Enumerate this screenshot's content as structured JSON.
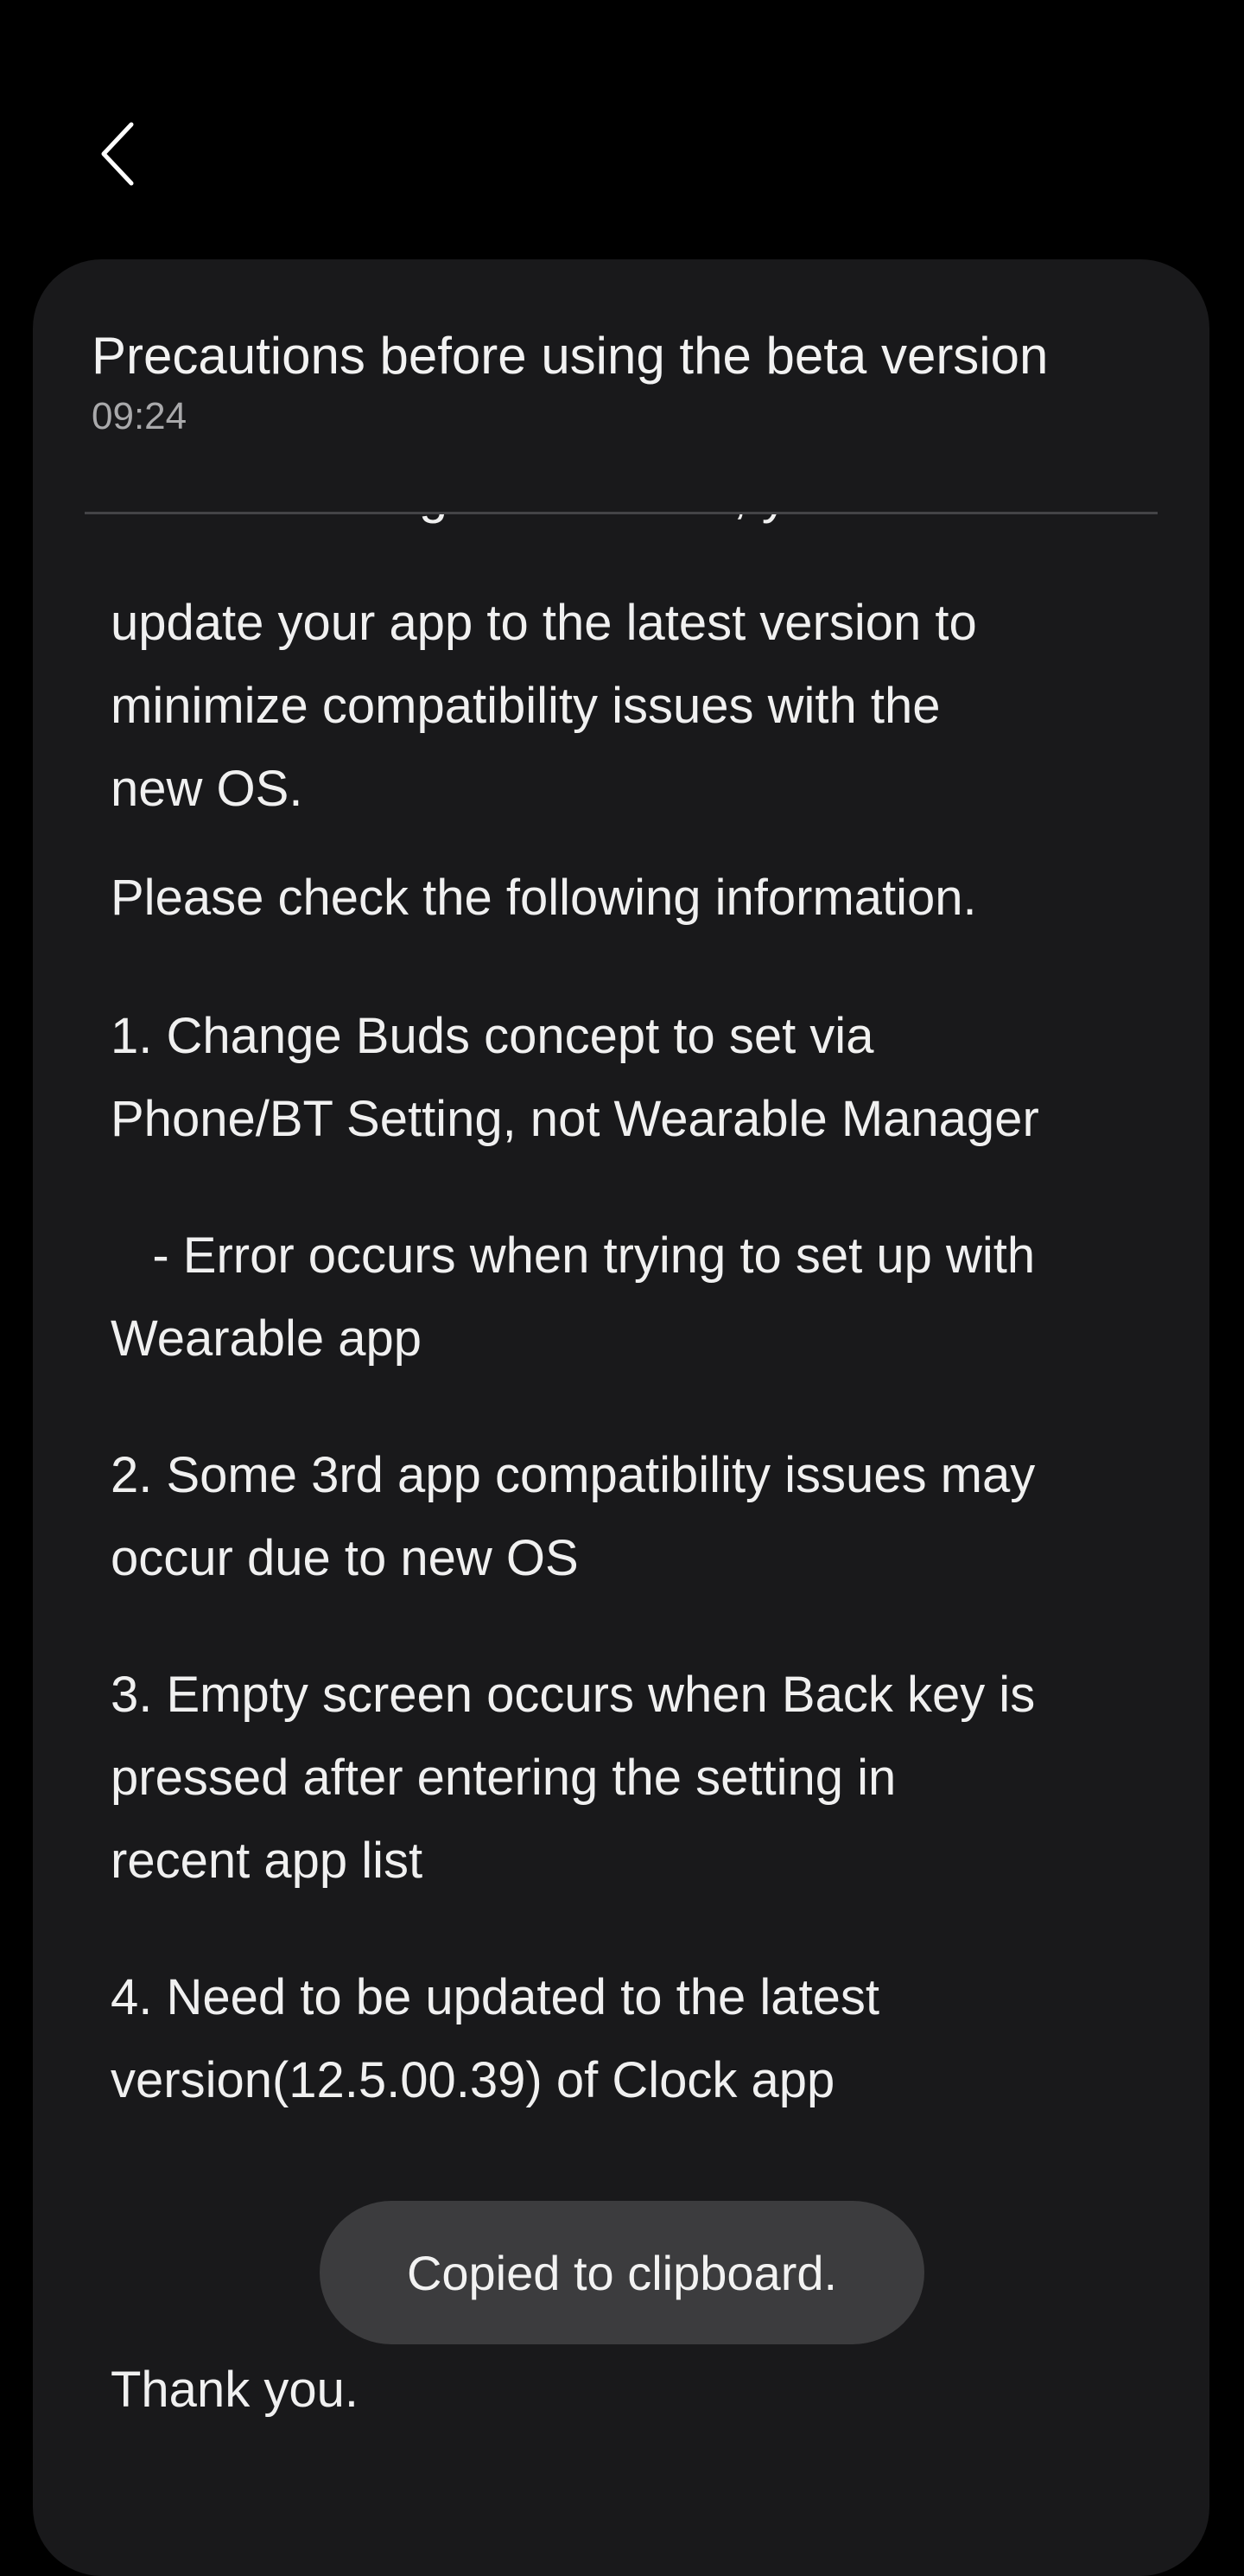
{
  "header": {
    "back_icon": "chevron-left-icon"
  },
  "message": {
    "title": "Precautions before using the beta version",
    "time": "09:24",
    "clipped_line": "…before using the new OS, you",
    "paragraphs": [
      "update your app to the latest version to\nminimize compatibility issues with the\nnew OS.",
      "Please check the following information.",
      "1. Change Buds concept to set via\nPhone/BT Setting, not Wearable Manager",
      "   - Error occurs when trying to set up with\nWearable app",
      "2. Some 3rd app compatibility issues may\noccur due to new OS",
      "3. Empty screen occurs when Back key is\npressed after entering the setting in\nrecent app list",
      "4. Need to be updated to the latest\nversion(12.5.00.39) of Clock app",
      "Thank you."
    ]
  },
  "toast": {
    "text": "Copied to clipboard."
  },
  "colors": {
    "background": "#000000",
    "card": "#19191b",
    "toast": "#3c3c3e"
  }
}
